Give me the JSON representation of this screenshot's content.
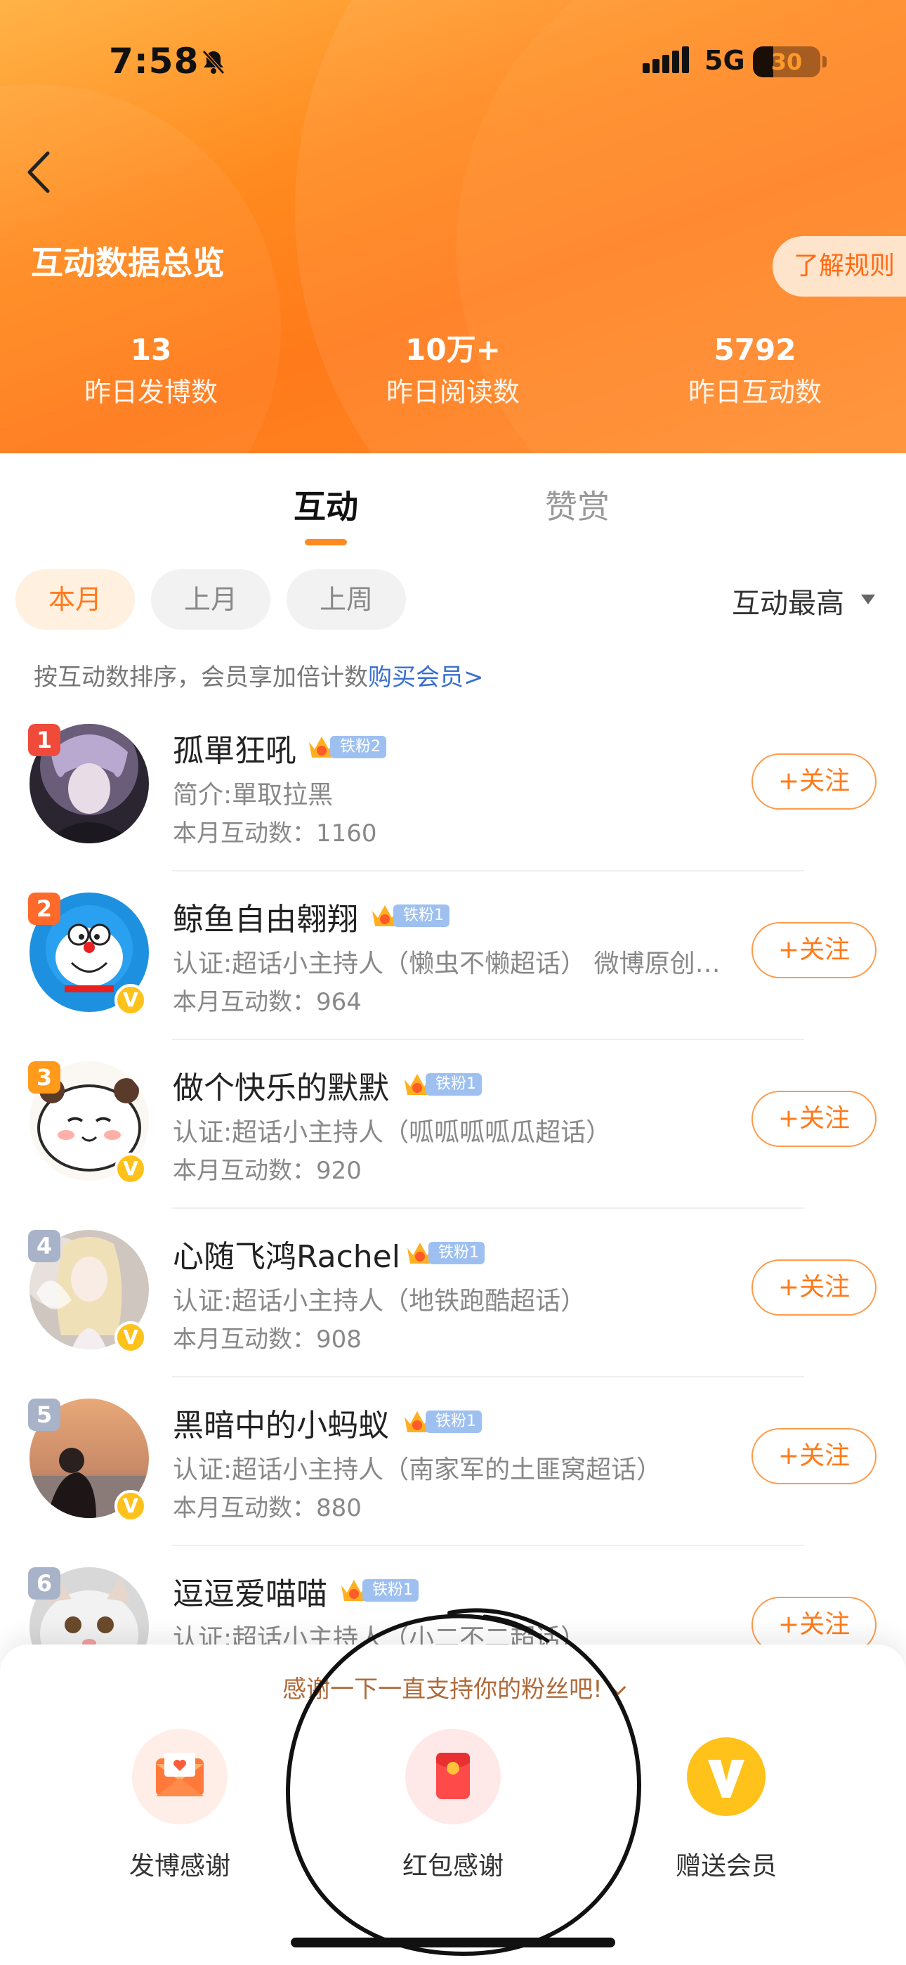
{
  "status_bar": {
    "time": "7:58",
    "network": "5G",
    "battery": "30",
    "battery_level": 0.3
  },
  "header": {
    "title": "互动数据总览",
    "rules_label": "了解规则",
    "stats": [
      {
        "value": "13",
        "label": "昨日发博数"
      },
      {
        "value": "10万+",
        "label": "昨日阅读数"
      },
      {
        "value": "5792",
        "label": "昨日互动数"
      }
    ]
  },
  "tabs": {
    "active": "互动",
    "inactive": "赞赏"
  },
  "filters": {
    "chips": [
      "本月",
      "上月",
      "上周"
    ],
    "sort": "互动最高"
  },
  "hint": {
    "text": "按互动数排序，会员享加倍计数",
    "link": "购买会员>"
  },
  "list": [
    {
      "rank": "1",
      "name": "孤單狂吼",
      "fan": "铁粉2",
      "desc": "简介:單取拉黑",
      "count": "本月互动数：1160",
      "follow": "+关注",
      "verified": false,
      "rank_color": "#f04a3a"
    },
    {
      "rank": "2",
      "name": "鲸鱼自由翱翔",
      "fan": "铁粉1",
      "desc": "认证:超话小主持人（懒虫不懒超话） 微博原创…",
      "count": "本月互动数：964",
      "follow": "+关注",
      "verified": true,
      "rank_color": "#ff6a2a"
    },
    {
      "rank": "3",
      "name": "做个快乐的默默",
      "fan": "铁粉1",
      "desc": "认证:超话小主持人（呱呱呱呱瓜超话）",
      "count": "本月互动数：920",
      "follow": "+关注",
      "verified": true,
      "rank_color": "#ff9a1a"
    },
    {
      "rank": "4",
      "name": "心随飞鸿Rachel",
      "fan": "铁粉1",
      "desc": "认证:超话小主持人（地铁跑酷超话）",
      "count": "本月互动数：908",
      "follow": "+关注",
      "verified": true,
      "rank_color": "#a8b2c8"
    },
    {
      "rank": "5",
      "name": "黑暗中的小蚂蚁",
      "fan": "铁粉1",
      "desc": "认证:超话小主持人（南家军的土匪窝超话）",
      "count": "本月互动数：880",
      "follow": "+关注",
      "verified": true,
      "rank_color": "#a8b2c8"
    },
    {
      "rank": "6",
      "name": "逗逗爱喵喵",
      "fan": "铁粉1",
      "desc": "认证:超话小主持人（小二不二超话）",
      "count": "",
      "follow": "+关注",
      "verified": false,
      "rank_color": "#a8b2c8"
    }
  ],
  "sheet": {
    "banner": "感谢一下一直支持你的粉丝吧!",
    "actions": [
      {
        "label": "发博感谢",
        "icon": "envelope-heart-icon"
      },
      {
        "label": "红包感谢",
        "icon": "red-packet-icon"
      },
      {
        "label": "赠送会员",
        "icon": "vip-v-icon"
      }
    ]
  },
  "colors": {
    "accent": "#ff7a1a",
    "link": "#3a6fd0",
    "fan_pill": "#9ec0f0",
    "vip_gold": "#ffc21a"
  }
}
